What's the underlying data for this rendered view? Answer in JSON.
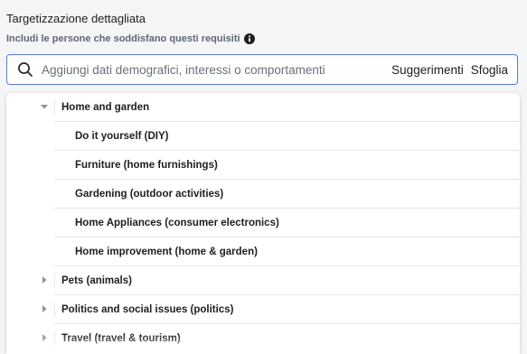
{
  "header": {
    "title": "Targetizzazione dettagliata",
    "subtitle": "Includi le persone che soddisfano questi requisiti"
  },
  "search": {
    "placeholder": "Aggiungi dati demografici, interessi o comportamenti",
    "suggestions_label": "Suggerimenti",
    "browse_label": "Sfoglia"
  },
  "tree": {
    "expanded": {
      "label": "Home and garden",
      "children": [
        {
          "label": "Do it yourself (DIY)"
        },
        {
          "label": "Furniture (home furnishings)"
        },
        {
          "label": "Gardening (outdoor activities)"
        },
        {
          "label": "Home Appliances (consumer electronics)"
        },
        {
          "label": "Home improvement (home & garden)"
        }
      ]
    },
    "collapsed": [
      {
        "label": "Pets (animals)"
      },
      {
        "label": "Politics and social issues (politics)"
      },
      {
        "label": "Travel (travel & tourism)"
      }
    ]
  },
  "colors": {
    "accent_border": "#5b78d7",
    "text_primary": "#1c1e21",
    "text_secondary": "#606770",
    "divider": "#e4e6eb"
  }
}
